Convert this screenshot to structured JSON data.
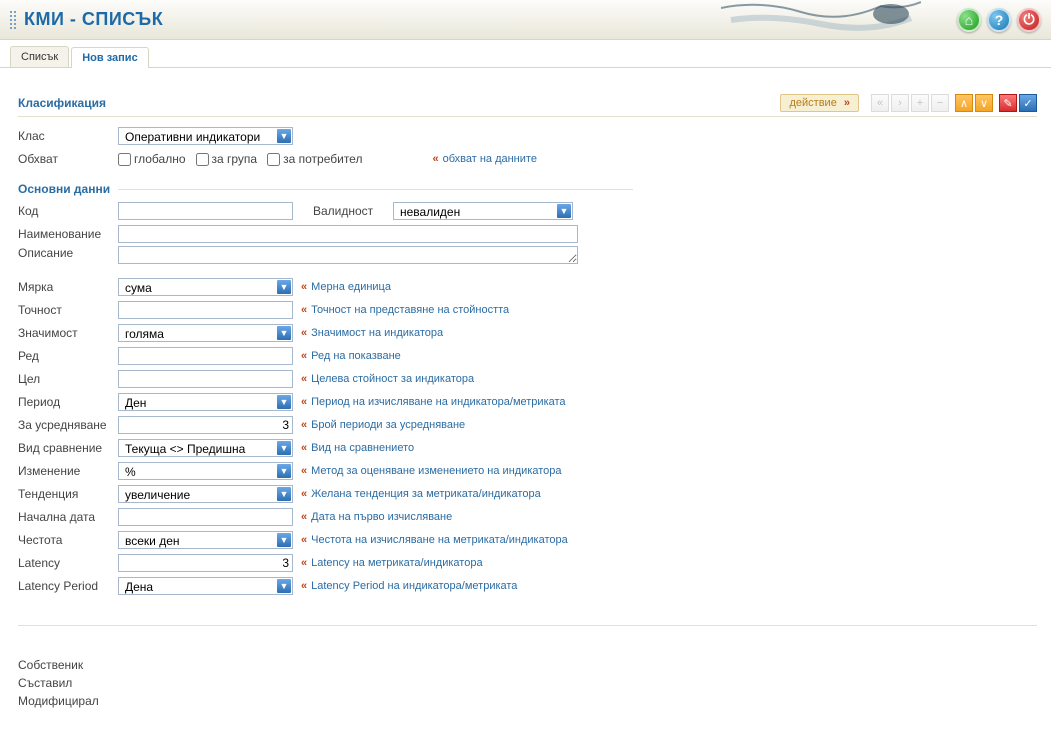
{
  "header": {
    "title": "КМИ - СПИСЪК"
  },
  "tabs": {
    "list": "Списък",
    "new": "Нов запис"
  },
  "sections": {
    "classification": "Класификация",
    "basic": "Основни данни"
  },
  "toolbar": {
    "action": "действие"
  },
  "labels": {
    "class": "Клас",
    "scope": "Обхват",
    "code": "Код",
    "validity": "Валидност",
    "name": "Наименование",
    "description": "Описание",
    "measure": "Мярка",
    "precision": "Точност",
    "significance": "Значимост",
    "order": "Ред",
    "goal": "Цел",
    "period": "Период",
    "averaging": "За усредняване",
    "compare_type": "Вид сравнение",
    "change": "Изменение",
    "trend": "Тенденция",
    "start_date": "Начална дата",
    "frequency": "Честота",
    "latency": "Latency",
    "latency_period": "Latency Period",
    "owner": "Собственик",
    "creator": "Съставил",
    "modifier": "Модифицирал"
  },
  "scope_chk": {
    "global": "глобално",
    "group": "за група",
    "user": "за потребител"
  },
  "hints": {
    "scope": "обхват на данните",
    "measure": "Мерна единица",
    "precision": "Точност на представяне на стойността",
    "significance": "Значимост на индикатора",
    "order": "Ред на показване",
    "goal": "Целева стойност за индикатора",
    "period": "Период на изчисляване на индикатора/метриката",
    "averaging": "Брой периоди за усредняване",
    "compare": "Вид на сравнението",
    "change": "Метод за оценяване изменението на индикатора",
    "trend": "Желана тенденция за метриката/индикатора",
    "start_date": "Дата на първо изчисляване",
    "frequency": "Честота на изчисляване на метриката/индикатора",
    "latency": "Latency на метриката/индикатора",
    "latency_period": "Latency Period на индикатора/метриката"
  },
  "values": {
    "class": "Оперативни индикатори",
    "validity": "невалиден",
    "measure": "сума",
    "significance": "голяма",
    "period": "Ден",
    "averaging": "3",
    "compare": "Текуща <> Предишна",
    "change": "%",
    "trend": "увеличение",
    "frequency": "всеки ден",
    "latency": "3",
    "latency_period": "Дена"
  }
}
